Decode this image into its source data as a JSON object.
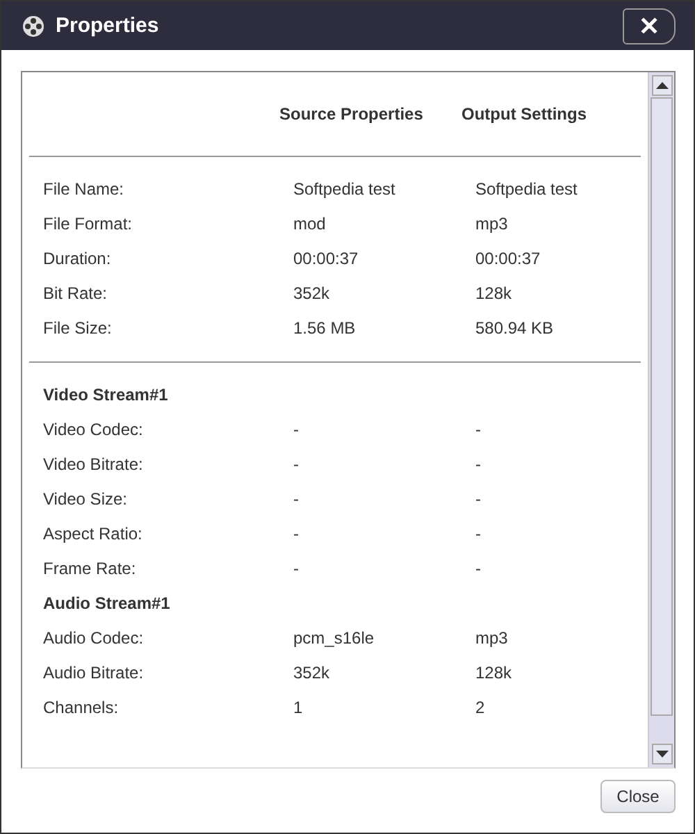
{
  "window": {
    "title": "Properties",
    "close": "✕"
  },
  "table": {
    "columns": [
      "Source Properties",
      "Output Settings"
    ],
    "sections": [
      {
        "rows": [
          {
            "kind": "row",
            "label": "File Name:",
            "source": "Softpedia test",
            "output": "Softpedia test"
          },
          {
            "kind": "row",
            "label": "File Format:",
            "source": "mod",
            "output": "mp3"
          },
          {
            "kind": "row",
            "label": "Duration:",
            "source": "00:00:37",
            "output": "00:00:37"
          },
          {
            "kind": "row",
            "label": "Bit Rate:",
            "source": "352k",
            "output": "128k"
          },
          {
            "kind": "row",
            "label": "File Size:",
            "source": "1.56 MB",
            "output": "580.94 KB"
          }
        ]
      },
      {
        "rows": [
          {
            "kind": "heading",
            "label": "Video Stream#1"
          },
          {
            "kind": "row",
            "label": "Video Codec:",
            "source": "-",
            "output": "-"
          },
          {
            "kind": "row",
            "label": "Video Bitrate:",
            "source": "-",
            "output": "-"
          },
          {
            "kind": "row",
            "label": "Video Size:",
            "source": "-",
            "output": "-"
          },
          {
            "kind": "row",
            "label": "Aspect Ratio:",
            "source": "-",
            "output": "-"
          },
          {
            "kind": "row",
            "label": "Frame Rate:",
            "source": "-",
            "output": "-"
          },
          {
            "kind": "heading",
            "label": "Audio Stream#1"
          },
          {
            "kind": "row",
            "label": "Audio Codec:",
            "source": "pcm_s16le",
            "output": "mp3"
          },
          {
            "kind": "row",
            "label": "Audio Bitrate:",
            "source": "352k",
            "output": "128k"
          },
          {
            "kind": "row",
            "label": "Channels:",
            "source": "1",
            "output": "2"
          }
        ]
      }
    ]
  },
  "buttons": [
    "Close"
  ]
}
